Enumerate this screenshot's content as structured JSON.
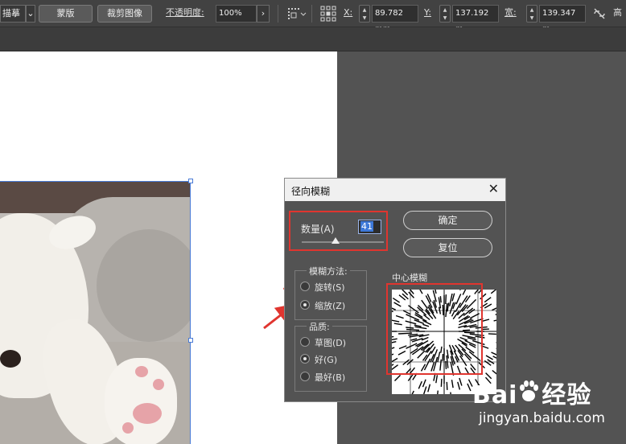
{
  "toolbar": {
    "trace_label": "描摹",
    "mask_label": "蒙版",
    "crop_label": "裁剪图像",
    "opacity_label": "不透明度:",
    "opacity_underline": "度",
    "opacity_value": "100%",
    "x_label": "X:",
    "x_value": "89.782 mm",
    "y_label": "Y:",
    "y_value": "137.192 m",
    "w_label": "宽:",
    "w_value": "139.347 m",
    "h_label": "高"
  },
  "dialog": {
    "title": "径向模糊",
    "amount_label": "数量(A)",
    "amount_value": "41",
    "amount_fraction": 0.41,
    "ok_label": "确定",
    "reset_label": "复位",
    "blur_method": {
      "title": "模糊方法:",
      "options": [
        {
          "label": "旋转(S)",
          "checked": false
        },
        {
          "label": "缩放(Z)",
          "checked": true
        }
      ]
    },
    "quality": {
      "title": "品质:",
      "options": [
        {
          "label": "草图(D)",
          "checked": false
        },
        {
          "label": "好(G)",
          "checked": true
        },
        {
          "label": "最好(B)",
          "checked": false
        }
      ]
    },
    "center_label": "中心模糊"
  },
  "watermark": {
    "logo_prefix": "Bai",
    "logo_suffix": "经验",
    "url": "jingyan.baidu.com"
  },
  "colors": {
    "annotation_red": "#e0352f",
    "selection_blue": "#4a7bd6"
  },
  "icons": [
    "chevron-down-icon",
    "chevron-right-icon",
    "align-grid-icon",
    "reference-point-icon",
    "link-constrain-icon",
    "close-icon",
    "baidu-paw-icon"
  ]
}
